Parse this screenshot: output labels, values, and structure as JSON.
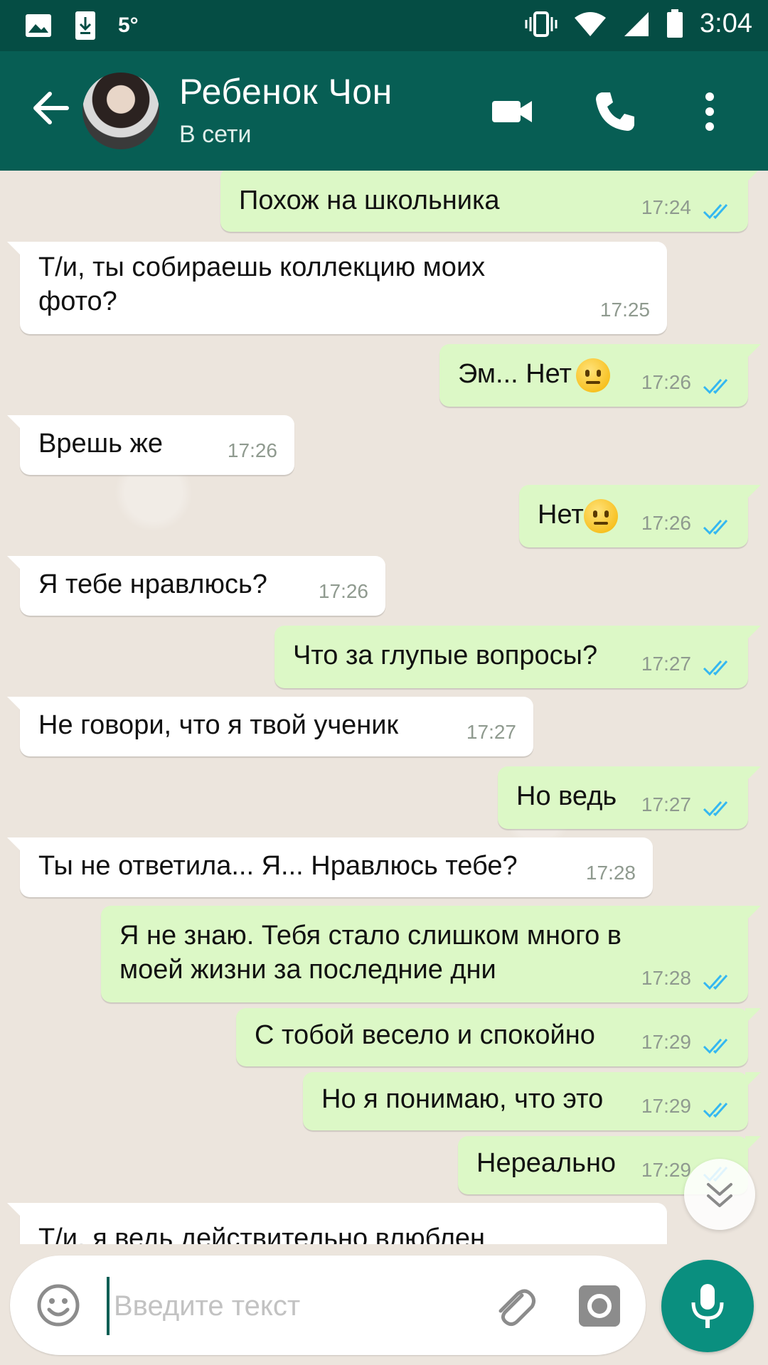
{
  "status_bar": {
    "temperature": "5°",
    "time": "3:04",
    "icons": [
      "gallery-icon",
      "download-icon",
      "vibrate-icon",
      "wifi-icon",
      "signal-icon",
      "battery-icon"
    ]
  },
  "header": {
    "contact_name": "Ребенок Чон",
    "contact_status": "В сети",
    "icons": [
      "back-arrow-icon",
      "avatar",
      "video-call-icon",
      "phone-icon",
      "more-vert-icon"
    ]
  },
  "messages": [
    {
      "dir": "out",
      "text": "Похож на школьника",
      "time": "17:24",
      "read": true
    },
    {
      "dir": "in",
      "text": "Т/и, ты собираешь коллекцию моих\nфото?",
      "time": "17:25"
    },
    {
      "dir": "out",
      "text": "Эм... Нет",
      "emoji": "neutral-face",
      "time": "17:26",
      "read": true
    },
    {
      "dir": "in",
      "text": "Врешь же",
      "time": "17:26"
    },
    {
      "dir": "out",
      "text": "Нет",
      "emoji": "neutral-face",
      "time": "17:26",
      "read": true
    },
    {
      "dir": "in",
      "text": "Я тебе нравлюсь?",
      "time": "17:26"
    },
    {
      "dir": "out",
      "text": "Что за глупые вопросы?",
      "time": "17:27",
      "read": true
    },
    {
      "dir": "in",
      "text": "Не говори, что я твой ученик",
      "time": "17:27"
    },
    {
      "dir": "out",
      "text": "Но ведь",
      "time": "17:27",
      "read": true
    },
    {
      "dir": "in",
      "text": "Ты не ответила... Я... Нравлюсь тебе?",
      "time": "17:28"
    },
    {
      "dir": "out",
      "text": "Я не знаю. Тебя стало слишком много в\nмоей жизни за последние дни",
      "time": "17:28",
      "read": true
    },
    {
      "dir": "out",
      "text": "С тобой весело и спокойно",
      "time": "17:29",
      "read": true
    },
    {
      "dir": "out",
      "text": "Но я понимаю, что это",
      "time": "17:29",
      "read": true
    },
    {
      "dir": "out",
      "text": "Нереально",
      "time": "17:29",
      "read": true
    },
    {
      "dir": "in",
      "text": "Т/и, я ведь действительно влюблен",
      "time": ""
    }
  ],
  "input": {
    "placeholder": "Введите текст",
    "value": ""
  },
  "colors": {
    "header": "#075e54",
    "status_bar": "#054d44",
    "outgoing_bubble": "#dcf8c6",
    "incoming_bubble": "#ffffff",
    "read_ticks": "#34b7f1",
    "mic_button": "#0a8f7f"
  }
}
